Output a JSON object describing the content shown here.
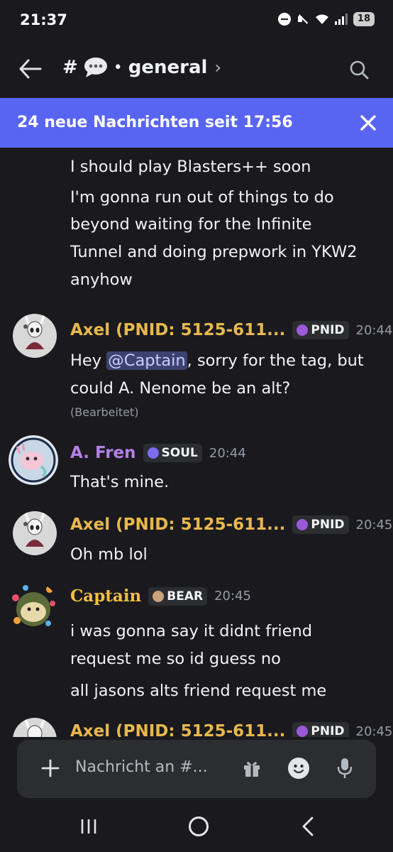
{
  "status_bar": {
    "time": "21:37",
    "battery": "18"
  },
  "header": {
    "hash": "#",
    "bullet": "•",
    "channel_name": "general",
    "chevron": "›"
  },
  "banner": {
    "text": "24 neue Nachrichten seit 17:56",
    "close": "✕"
  },
  "messages": {
    "continuation": [
      "I should play Blasters++ soon",
      "I'm gonna run out of things to do",
      "beyond waiting for the Infinite",
      "Tunnel and doing prepwork in YKW2",
      "anyhow"
    ],
    "m1": {
      "author": "Axel (PNID: 5125-611...",
      "tag": "PNID",
      "time": "20:44",
      "line1_pre": "Hey ",
      "mention": "@Captain",
      "line1_post": ", sorry for the tag, but",
      "line2": "could A. Nenome be an alt?",
      "edited": "(Bearbeitet)"
    },
    "m2": {
      "author": "A. Fren",
      "tag": "SOUL",
      "time": "20:44",
      "line1": "That's mine."
    },
    "m3": {
      "author": "Axel (PNID: 5125-611...",
      "tag": "PNID",
      "time": "20:45",
      "line1": "Oh mb lol"
    },
    "m4": {
      "author": "Captain",
      "tag": "BEAR",
      "time": "20:45",
      "line1": "i was gonna say it didnt friend",
      "line2": "request me so id guess no",
      "line3": "all jasons alts friend request me"
    },
    "m5": {
      "author": "Axel (PNID: 5125-611...",
      "tag": "PNID",
      "time": "20:45"
    }
  },
  "composer": {
    "placeholder": "Nachricht an #..."
  },
  "colors": {
    "accent": "#5865f2",
    "axel_name": "#e8b84d",
    "fren_name": "#b47fe8",
    "captain_name": "#f0c040"
  },
  "icons": {
    "back": "arrow-left-icon",
    "search": "search-icon",
    "close": "close-icon",
    "plus": "plus-icon",
    "gift": "gift-icon",
    "emoji": "emoji-icon",
    "mic": "microphone-icon"
  }
}
